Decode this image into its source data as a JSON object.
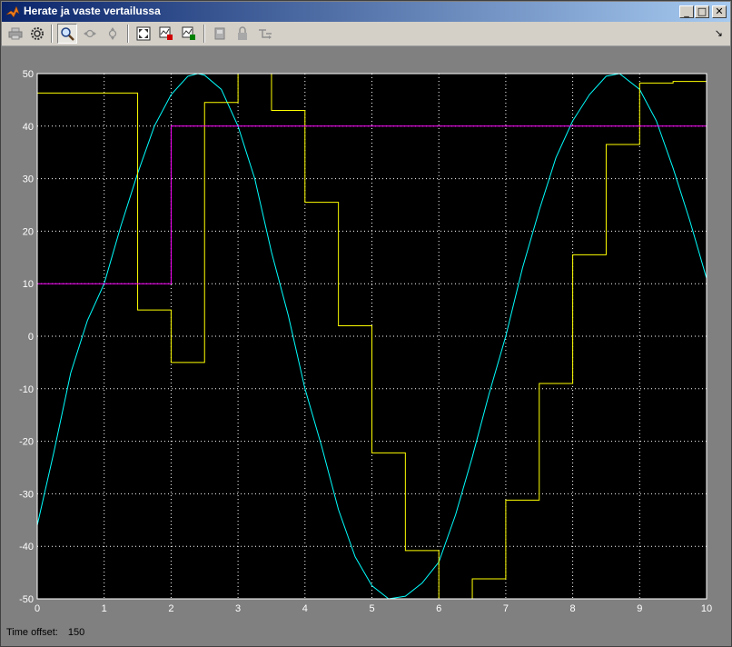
{
  "window": {
    "title": "Herate ja vaste vertailussa"
  },
  "window_buttons": {
    "minimize": "_",
    "maximize": "□",
    "close": "✕"
  },
  "toolbar": {
    "items": [
      {
        "name": "print-icon",
        "enabled": false
      },
      {
        "name": "parameters-icon",
        "enabled": true
      },
      {
        "name": "zoom-icon",
        "enabled": true,
        "pressed": true
      },
      {
        "name": "zoom-x-icon",
        "enabled": false
      },
      {
        "name": "zoom-y-icon",
        "enabled": false
      },
      {
        "name": "autoscale-icon",
        "enabled": true
      },
      {
        "name": "save-axes-settings-icon",
        "enabled": true
      },
      {
        "name": "restore-axes-settings-icon",
        "enabled": true
      },
      {
        "name": "floating-scope-icon",
        "enabled": false
      },
      {
        "name": "lock-axes-icon",
        "enabled": false
      },
      {
        "name": "signal-selection-icon",
        "enabled": false
      }
    ],
    "dock_label": "↘"
  },
  "status": {
    "label": "Time offset:",
    "value": "150"
  },
  "colors": {
    "background": "#000000",
    "axes": "#ffffff",
    "grid": "#ffffff"
  },
  "chart_data": {
    "type": "line",
    "xlim": [
      0,
      10
    ],
    "ylim": [
      -50,
      50
    ],
    "grid": true,
    "x_ticks": [
      "0",
      "1",
      "2",
      "3",
      "4",
      "5",
      "6",
      "7",
      "8",
      "9",
      "10"
    ],
    "y_ticks": [
      "50",
      "40",
      "30",
      "20",
      "10",
      "0",
      "-10",
      "-20",
      "-30",
      "-40",
      "-50"
    ],
    "series": [
      {
        "color": "#00ffff",
        "kind": "line",
        "x": [
          0,
          0.25,
          0.5,
          0.75,
          1,
          1.25,
          1.5,
          1.75,
          2,
          2.25,
          2.4,
          2.5,
          2.75,
          3,
          3.25,
          3.5,
          3.75,
          4,
          4.25,
          4.5,
          4.75,
          5,
          5.25,
          5.5,
          5.75,
          6,
          6.25,
          6.5,
          6.75,
          7,
          7.25,
          7.5,
          7.75,
          8,
          8.25,
          8.5,
          8.7,
          9,
          9.25,
          9.5,
          9.75,
          10
        ],
        "y": [
          -36,
          -22,
          -7,
          3,
          10,
          21,
          31,
          40,
          46,
          49.5,
          50,
          49.7,
          47,
          40,
          30,
          16,
          4,
          -10,
          -21,
          -33,
          -42,
          -47.5,
          -50,
          -49.5,
          -47,
          -43,
          -34,
          -23,
          -11,
          0,
          13,
          24,
          34,
          41,
          46,
          49.5,
          50,
          47,
          41,
          32,
          22,
          11
        ]
      },
      {
        "color": "#ffff00",
        "kind": "step",
        "x": [
          0,
          1.5,
          2,
          2.5,
          3,
          3.5,
          4,
          4.5,
          5,
          5.5,
          6,
          6.5,
          7,
          7.5,
          8,
          8.5,
          9,
          9.5,
          10
        ],
        "y": [
          46.3,
          5,
          -5,
          44.5,
          50,
          43,
          25.5,
          2,
          -22.2,
          -40.8,
          -50,
          -46.2,
          -31.2,
          -9,
          15.5,
          36.5,
          48.2,
          48.5,
          48.5
        ]
      },
      {
        "color": "#ff00ff",
        "kind": "step",
        "x": [
          0,
          2,
          10
        ],
        "y": [
          10,
          40,
          40
        ]
      }
    ]
  }
}
